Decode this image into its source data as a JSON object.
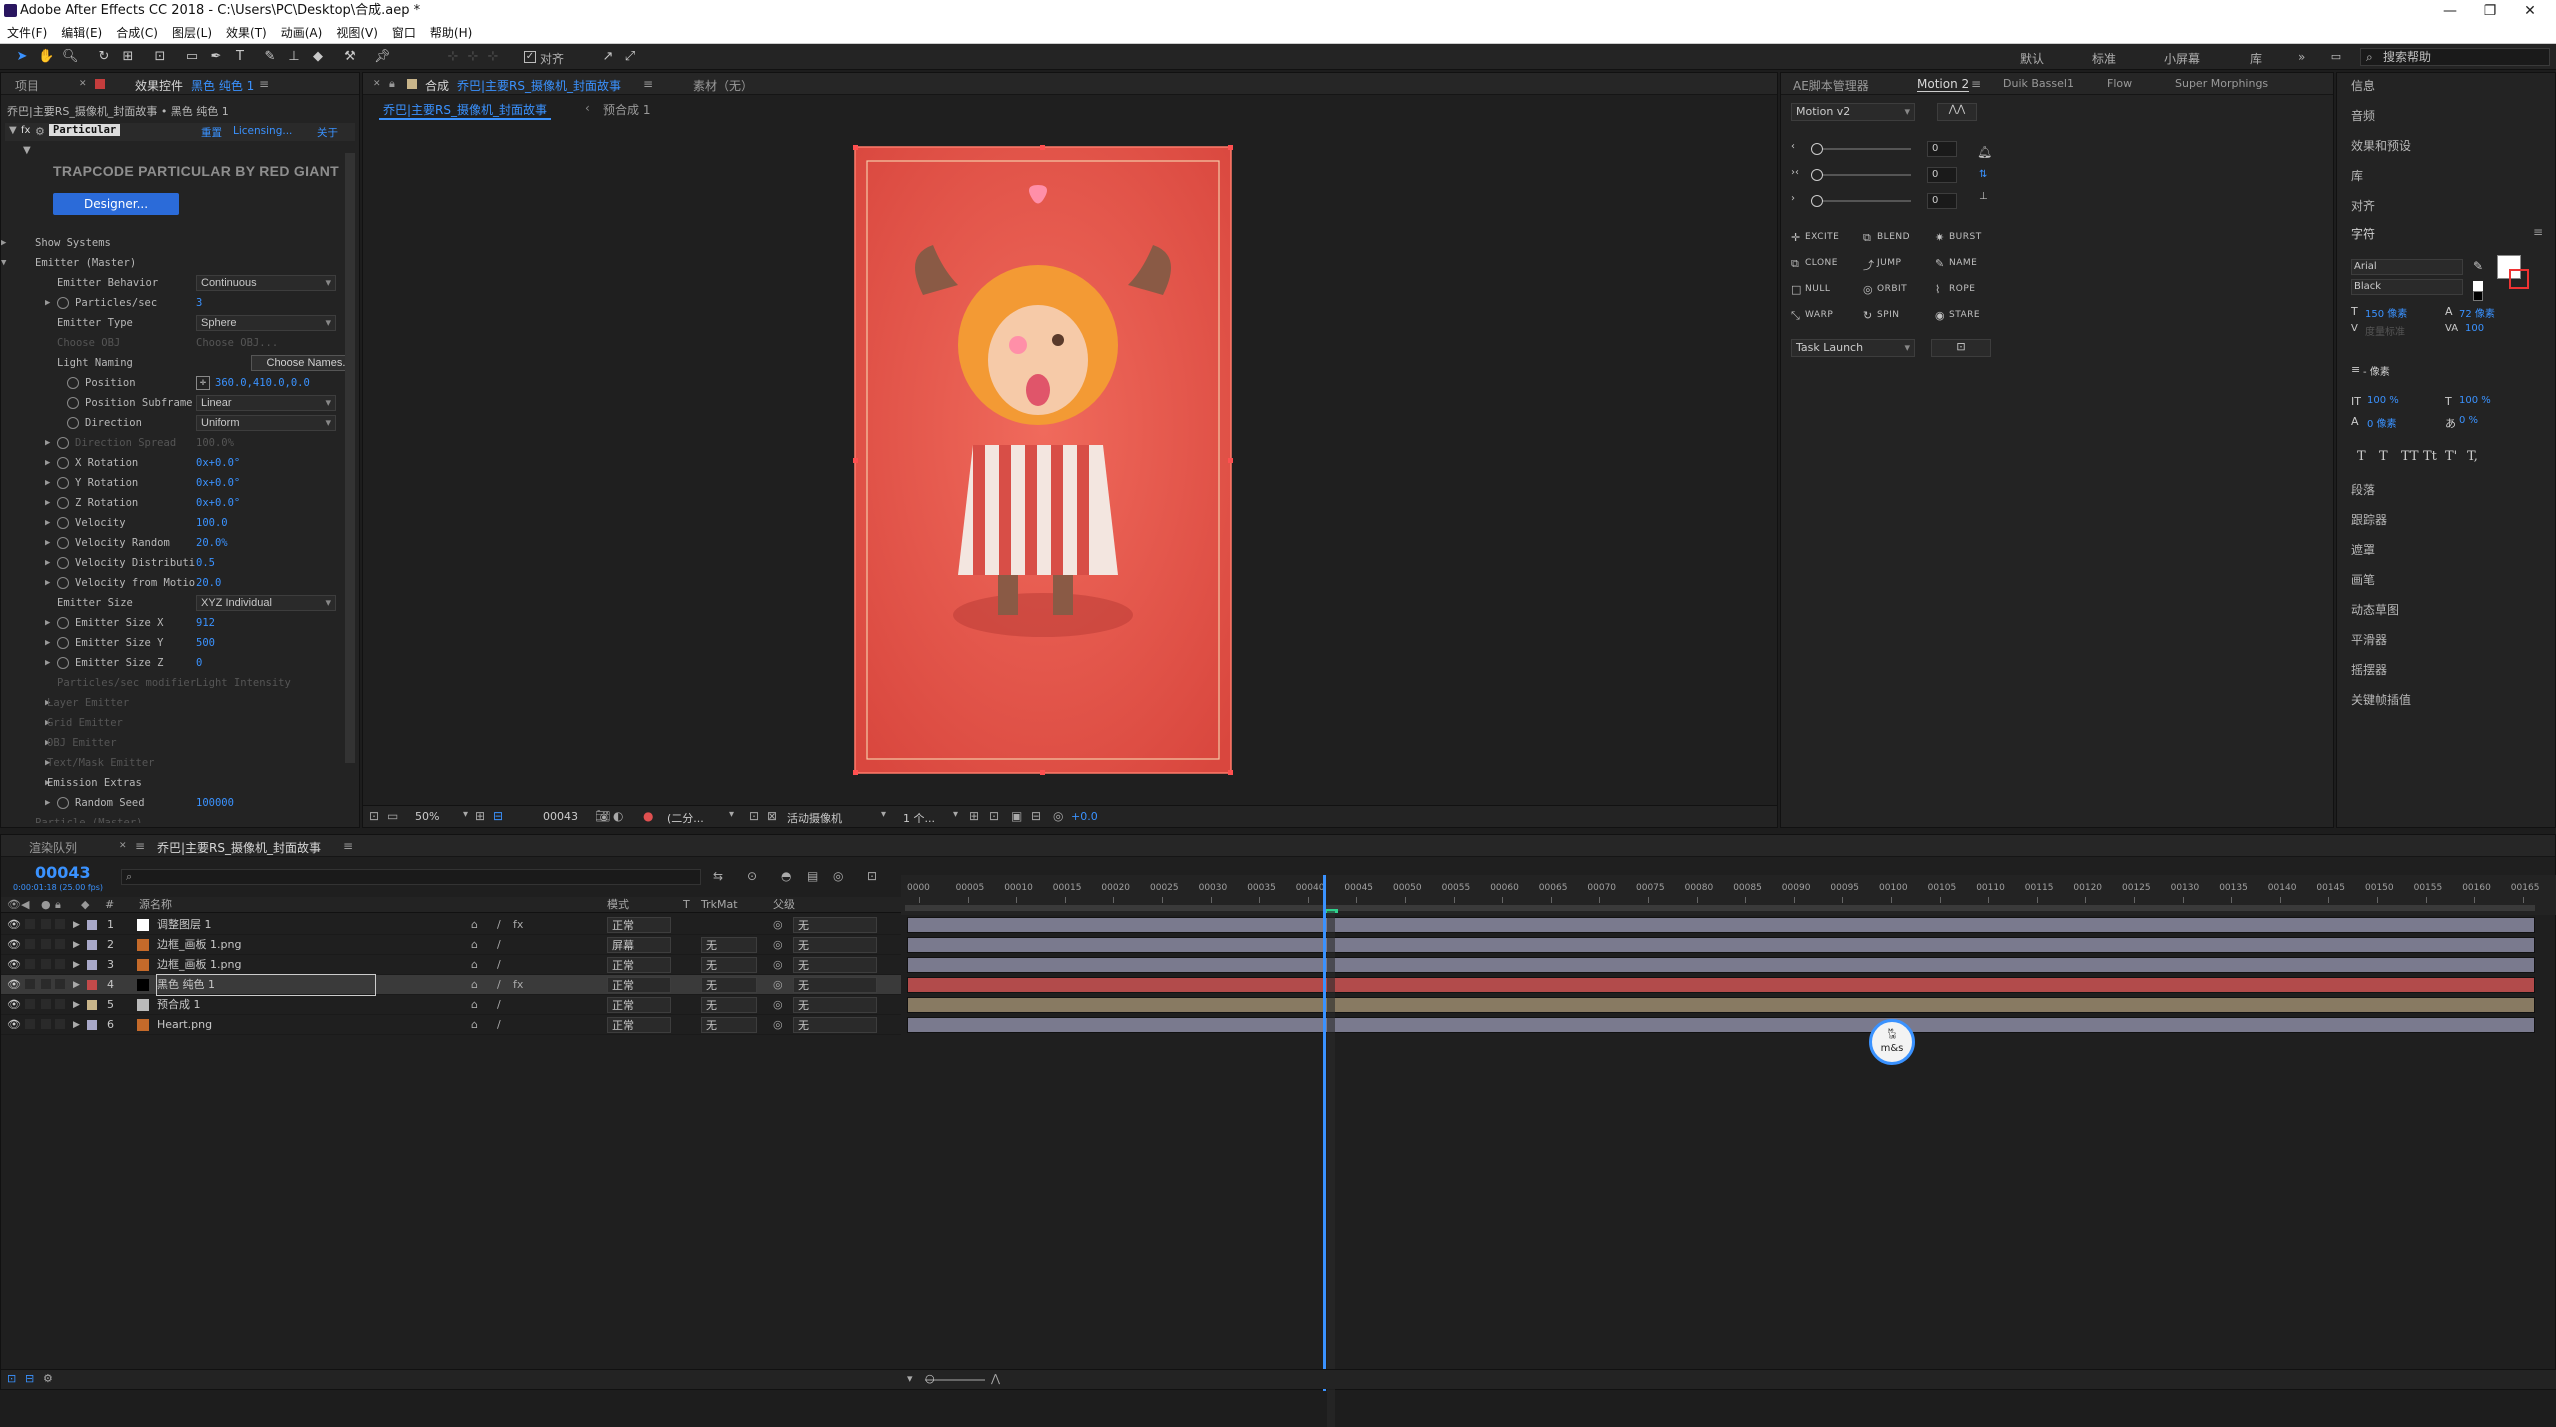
{
  "window": {
    "title": "Adobe After Effects CC 2018 - C:\\Users\\PC\\Desktop\\合成.aep *",
    "minimize": "—",
    "maximize": "❐",
    "close": "✕"
  },
  "menu": [
    "文件(F)",
    "编辑(E)",
    "合成(C)",
    "图层(L)",
    "效果(T)",
    "动画(A)",
    "视图(V)",
    "窗口",
    "帮助(H)"
  ],
  "toolbar": {
    "snap_label": "对齐",
    "workspaces": [
      "默认",
      "标准",
      "小屏幕",
      "库"
    ],
    "more": "»",
    "search_placeholder": "搜索帮助"
  },
  "left_panel": {
    "tab_project": "项目",
    "tab_effects": "效果控件",
    "tab_effects_layer": "黑色 纯色 1",
    "breadcrumb": "乔巴|主要RS_摄像机_封面故事 • 黑色 纯色 1",
    "effect_name": "Particular",
    "reset": "重置",
    "licensing": "Licensing...",
    "about": "关于",
    "brand": "TRAPCODE PARTICULAR BY RED GIANT",
    "designer_button": "Designer...",
    "rows": [
      {
        "label": "Show Systems",
        "type": "group",
        "indent": 1
      },
      {
        "label": "Emitter (Master)",
        "type": "group-open",
        "indent": 1
      },
      {
        "label": "Emitter Behavior",
        "dd": "Continuous",
        "indent": 3
      },
      {
        "label": "Particles/sec",
        "value": "3",
        "indent": 2,
        "sw": true
      },
      {
        "label": "Emitter Type",
        "dd": "Sphere",
        "indent": 3
      },
      {
        "label": "Choose OBJ",
        "value": "Choose OBJ...",
        "indent": 3,
        "dim": true
      },
      {
        "label": "Light Naming",
        "btn": "Choose Names...",
        "indent": 3
      },
      {
        "label": "Position",
        "value": "360.0,410.0,0.0",
        "indent": 3,
        "sw": true,
        "cross": true
      },
      {
        "label": "Position Subframe",
        "dd": "Linear",
        "indent": 3,
        "sw": true
      },
      {
        "label": "Direction",
        "dd": "Uniform",
        "indent": 3,
        "sw": true
      },
      {
        "label": "Direction Spread",
        "value": "100.0%",
        "indent": 2,
        "sw": true,
        "dim": true
      },
      {
        "label": "X Rotation",
        "value": "0x+0.0°",
        "indent": 2,
        "sw": true
      },
      {
        "label": "Y Rotation",
        "value": "0x+0.0°",
        "indent": 2,
        "sw": true
      },
      {
        "label": "Z Rotation",
        "value": "0x+0.0°",
        "indent": 2,
        "sw": true
      },
      {
        "label": "Velocity",
        "value": "100.0",
        "indent": 2,
        "sw": true
      },
      {
        "label": "Velocity Random",
        "value": "20.0%",
        "indent": 2,
        "sw": true
      },
      {
        "label": "Velocity Distributi",
        "value": "0.5",
        "indent": 2,
        "sw": true
      },
      {
        "label": "Velocity from Motio",
        "value": "20.0",
        "indent": 2,
        "sw": true
      },
      {
        "label": "Emitter Size",
        "dd": "XYZ Individual",
        "indent": 3
      },
      {
        "label": "Emitter Size X",
        "value": "912",
        "indent": 2,
        "sw": true
      },
      {
        "label": "Emitter Size Y",
        "value": "500",
        "indent": 2,
        "sw": true
      },
      {
        "label": "Emitter Size Z",
        "value": "0",
        "indent": 2,
        "sw": true
      },
      {
        "label": "Particles/sec modifier",
        "value": "Light Intensity",
        "indent": 3,
        "dim": true
      },
      {
        "label": "Layer Emitter",
        "indent": 2,
        "dim": true
      },
      {
        "label": "Grid Emitter",
        "indent": 2,
        "dim": true
      },
      {
        "label": "OBJ Emitter",
        "indent": 2,
        "dim": true
      },
      {
        "label": "Text/Mask Emitter",
        "indent": 2,
        "dim": true
      },
      {
        "label": "Emission Extras",
        "indent": 2
      },
      {
        "label": "Random Seed",
        "value": "100000",
        "indent": 2,
        "sw": true
      },
      {
        "label": "Particle (Master)",
        "indent": 1,
        "dim": true
      }
    ]
  },
  "viewer": {
    "tab_comp": "合成",
    "comp_name": "乔巴|主要RS_摄像机_封面故事",
    "tab_footage": "素材（无）",
    "flow_comp": "乔巴|主要RS_摄像机_封面故事",
    "flow_next": "预合成 1",
    "zoom": "50%",
    "frame": "00043",
    "resolution": "(二分...",
    "camera": "活动摄像机",
    "views": "1 个...",
    "exposure": "+0.0"
  },
  "motion_panel": {
    "tab_script": "AE脚本管理器",
    "tab_motion": "Motion 2",
    "tab_duik": "Duik Bassel1",
    "tab_flow": "Flow",
    "tab_super": "Super Morphings",
    "version": "Motion v2",
    "slider_values": [
      "0",
      "0",
      "0"
    ],
    "buttons": [
      [
        "EXCITE",
        "BLEND",
        "BURST"
      ],
      [
        "CLONE",
        "JUMP",
        "NAME"
      ],
      [
        "NULL",
        "ORBIT",
        "ROPE"
      ],
      [
        "WARP",
        "SPIN",
        "STARE"
      ]
    ],
    "task": "Task Launch"
  },
  "right_panel": {
    "items_top": [
      "信息",
      "音频",
      "效果和预设",
      "库",
      "对齐"
    ],
    "char_title": "字符",
    "font": "Arial",
    "style": "Black",
    "size": "150 像素",
    "leading": "72 像素",
    "kerning": "度量标准",
    "tracking": "100",
    "stroke": "- 像素",
    "vscale": "100 %",
    "hscale": "100 %",
    "baseline": "0 像素",
    "tsume": "0 %",
    "styles": [
      "T",
      "T",
      "TT",
      "Tt",
      "T'",
      "T,"
    ],
    "items_bottom": [
      "段落",
      "跟踪器",
      "遮罩",
      "画笔",
      "动态草图",
      "平滑器",
      "摇摆器",
      "关键帧插值"
    ]
  },
  "timeline": {
    "tab_render": "渲染队列",
    "tab_comp": "乔巴|主要RS_摄像机_封面故事",
    "timecode": "00043",
    "fps_info": "0:00:01:18 (25.00 fps)",
    "cols": {
      "num": "#",
      "name": "源名称",
      "mode": "模式",
      "t": "T",
      "trkmat": "TrkMat",
      "parent": "父级"
    },
    "layers": [
      {
        "num": "1",
        "name": "调整图层 1",
        "mode": "正常",
        "trk": "",
        "parent": "无",
        "color": "#a9a9c9",
        "bar": "#7a7a8e"
      },
      {
        "num": "2",
        "name": "边框_画板 1.png",
        "mode": "屏幕",
        "trk": "无",
        "parent": "无",
        "color": "#a9a9c9",
        "bar": "#7a7a8e"
      },
      {
        "num": "3",
        "name": "边框_画板 1.png",
        "mode": "正常",
        "trk": "无",
        "parent": "无",
        "color": "#a9a9c9",
        "bar": "#7a7a8e"
      },
      {
        "num": "4",
        "name": "黑色 纯色 1",
        "mode": "正常",
        "trk": "无",
        "parent": "无",
        "color": "#c34a4a",
        "bar": "#b24b4b"
      },
      {
        "num": "5",
        "name": "预合成 1",
        "mode": "正常",
        "trk": "无",
        "parent": "无",
        "color": "#c9b58a",
        "bar": "#887a62"
      },
      {
        "num": "6",
        "name": "Heart.png",
        "mode": "正常",
        "trk": "无",
        "parent": "无",
        "color": "#a9a9c9",
        "bar": "#7a7a8e"
      }
    ],
    "ruler": [
      "0000",
      "00005",
      "00010",
      "00015",
      "00020",
      "00025",
      "00030",
      "00035",
      "00040",
      "00045",
      "00050",
      "00055",
      "00060",
      "00065",
      "00070",
      "00075",
      "00080",
      "00085",
      "00090",
      "00095",
      "00100",
      "00105",
      "00110",
      "00115",
      "00120",
      "00125",
      "00130",
      "00135",
      "00140",
      "00145",
      "00150",
      "00155",
      "00160",
      "00165"
    ],
    "badge": "m&s"
  },
  "colors": {
    "accent": "#3a92ff",
    "canvas": "#e5554a",
    "layer_red": "#b24b4b"
  }
}
